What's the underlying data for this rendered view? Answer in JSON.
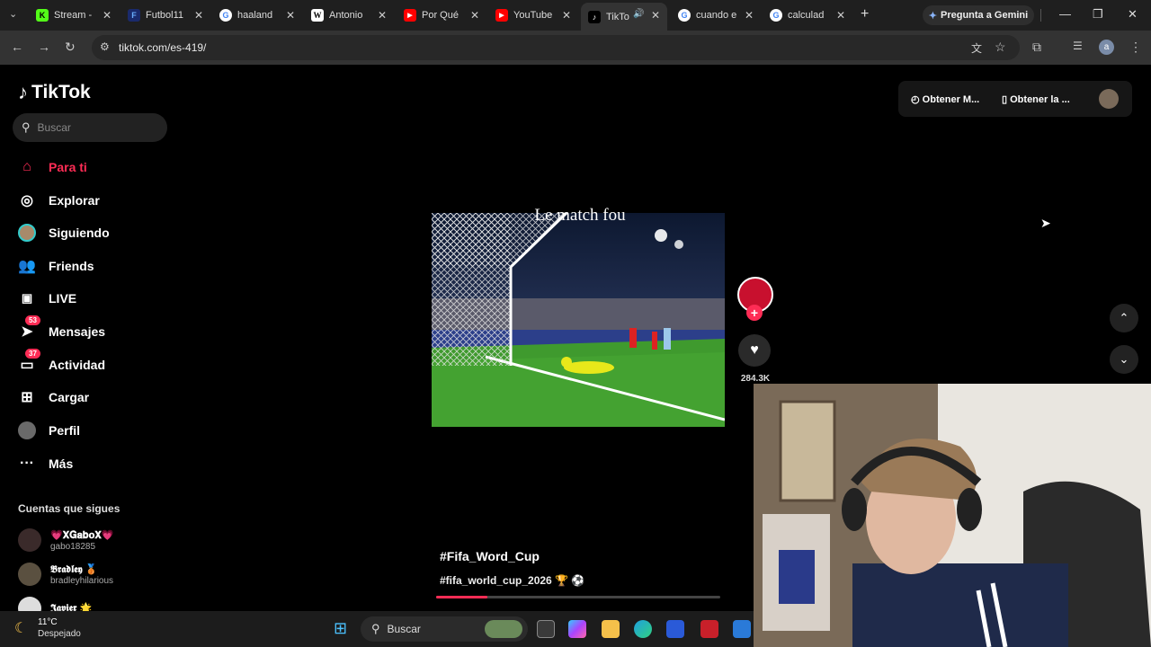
{
  "browser": {
    "tabs": [
      {
        "label": "Stream - ",
        "icon": "K"
      },
      {
        "label": "Futbol11",
        "icon": "F"
      },
      {
        "label": "haaland",
        "icon": "G"
      },
      {
        "label": "Antonio",
        "icon": "W"
      },
      {
        "label": "Por Qué",
        "icon": "▶"
      },
      {
        "label": "YouTube",
        "icon": "▶"
      },
      {
        "label": "TikTo",
        "icon": "♪"
      },
      {
        "label": "cuando e",
        "icon": "G"
      },
      {
        "label": "calculad",
        "icon": "G"
      }
    ],
    "gemini_label": "Pregunta a Gemini",
    "url": "tiktok.com/es-419/"
  },
  "tiktok": {
    "logo_text": "TikTok",
    "search_placeholder": "Buscar",
    "nav": [
      {
        "label": "Para ti",
        "icon": "home-icon"
      },
      {
        "label": "Explorar",
        "icon": "compass-icon"
      },
      {
        "label": "Siguiendo",
        "icon": "following-avatar-icon"
      },
      {
        "label": "Friends",
        "icon": "friends-icon"
      },
      {
        "label": "LIVE",
        "icon": "live-icon"
      },
      {
        "label": "Mensajes",
        "icon": "messages-icon",
        "badge": "53"
      },
      {
        "label": "Actividad",
        "icon": "activity-icon",
        "badge": "37"
      },
      {
        "label": "Cargar",
        "icon": "upload-icon"
      },
      {
        "label": "Perfil",
        "icon": "profile-avatar-icon"
      },
      {
        "label": "Más",
        "icon": "more-icon"
      }
    ],
    "following_title": "Cuentas que sigues",
    "accounts": [
      {
        "name": "💗𝐗𝐆𝐚𝐛𝐨𝐗💗",
        "handle": "gabo18285"
      },
      {
        "name": "𝕭𝖗𝖆𝖉𝖑𝖊𝖞 🥉",
        "handle": "bradleyhilarious"
      },
      {
        "name": "𝕵𝖆𝖛𝖎𝖊𝖗 🌟",
        "handle": ""
      }
    ],
    "top_right": {
      "btn1": "Obtener M...",
      "btn2": "Obtener la ..."
    },
    "video": {
      "overlay_text": "Le match fou",
      "title": "#Fifa_Word_Cup",
      "subtitle": "#fifa_world_cup_2026 🏆 ⚽",
      "progress": 0.18
    },
    "actions": {
      "like_count": "284.3K"
    }
  },
  "taskbar": {
    "weather_temp": "11°C",
    "weather_desc": "Despejado",
    "search_label": "Buscar"
  },
  "colors": {
    "accent": "#fe2c55",
    "background": "#000000"
  }
}
